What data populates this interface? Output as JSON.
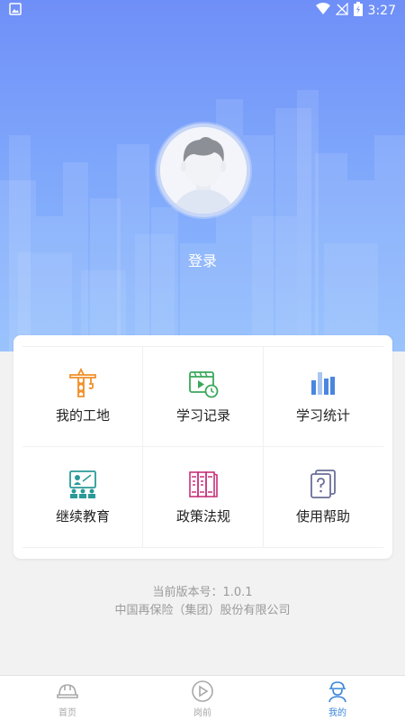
{
  "status_bar": {
    "time": "3:27"
  },
  "profile": {
    "login_label": "登录"
  },
  "menu": [
    {
      "label": "我的工地",
      "icon": "tower-crane-icon",
      "color": "#f0902a"
    },
    {
      "label": "学习记录",
      "icon": "video-clock-icon",
      "color": "#3aa75a"
    },
    {
      "label": "学习统计",
      "icon": "bar-stats-icon",
      "color": "#4a86e0"
    },
    {
      "label": "继续教育",
      "icon": "classroom-icon",
      "color": "#2a9a98"
    },
    {
      "label": "政策法规",
      "icon": "law-books-icon",
      "color": "#c8327a"
    },
    {
      "label": "使用帮助",
      "icon": "help-book-icon",
      "color": "#6a6f98"
    }
  ],
  "footer": {
    "version": "当前版本号：1.0.1",
    "company": "中国再保险（集团）股份有限公司"
  },
  "tabs": [
    {
      "label": "首页",
      "icon": "hardhat-icon",
      "active": false
    },
    {
      "label": "岗前",
      "icon": "play-circle-icon",
      "active": false
    },
    {
      "label": "我的",
      "icon": "worker-icon",
      "active": true
    }
  ],
  "colors": {
    "accent": "#3a86d9",
    "header_top": "#6f8ff8",
    "header_bottom": "#8fbcfd"
  }
}
